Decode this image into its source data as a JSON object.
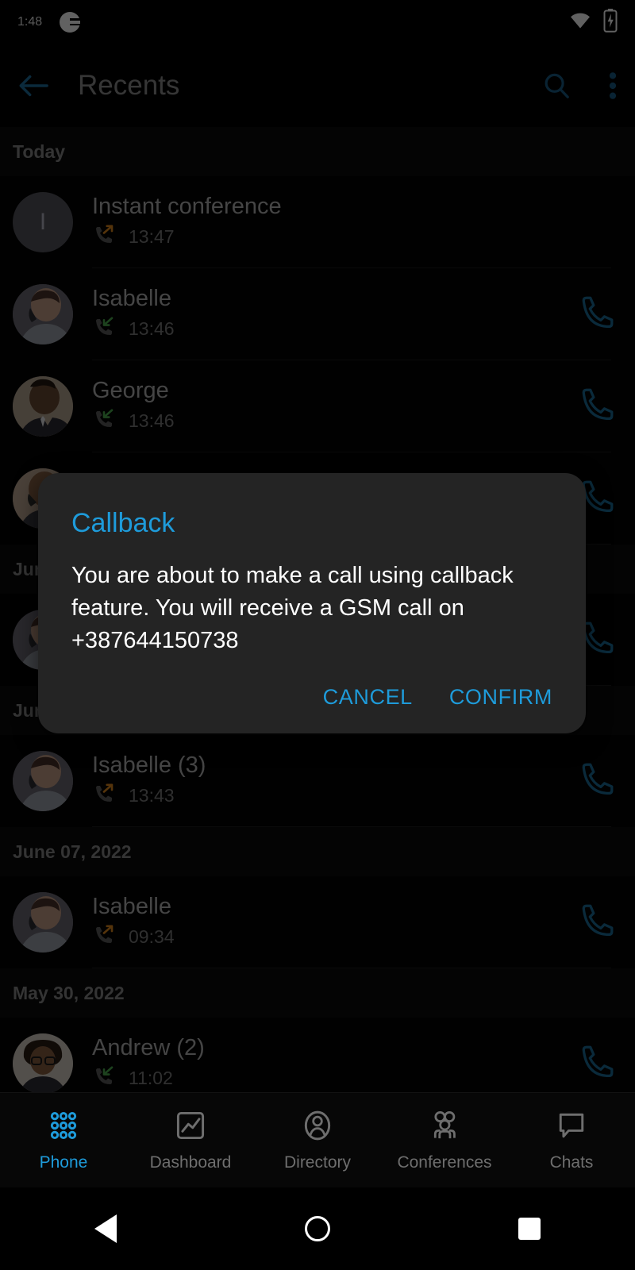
{
  "status_bar": {
    "time": "1:48",
    "app_icon": "notification-app-icon",
    "wifi_icon": "wifi-icon",
    "battery_icon": "battery-charging-icon"
  },
  "app_bar": {
    "back_icon": "arrow-back-icon",
    "title": "Recents",
    "search_icon": "search-icon",
    "overflow_icon": "more-vertical-icon"
  },
  "colors": {
    "accent": "#1e9bda",
    "background": "#000000",
    "list_background": "#050505",
    "dialog_background": "#242424",
    "incoming_arrow": "#4caf50",
    "outgoing_arrow": "#e08a1e",
    "primary_text": "#b6b6b6",
    "secondary_text": "#7c7c7c",
    "header_text": "#8a8a8a"
  },
  "call_list": [
    {
      "type": "date_header",
      "label": "Today"
    },
    {
      "type": "call",
      "name": "Instant conference",
      "time": "13:47",
      "direction": "outgoing",
      "avatar": "letter",
      "avatar_letter": "I",
      "has_call_button": false
    },
    {
      "type": "call",
      "name": "Isabelle",
      "time": "13:46",
      "direction": "incoming",
      "avatar": "photo-woman",
      "has_call_button": true
    },
    {
      "type": "call",
      "name": "George",
      "time": "13:46",
      "direction": "incoming",
      "avatar": "photo-man",
      "has_call_button": true
    },
    {
      "type": "call",
      "name": "",
      "time": "",
      "direction": "incoming",
      "avatar": "photo-man-2",
      "has_call_button": true,
      "obscured": true
    },
    {
      "type": "date_header",
      "label": "Jun",
      "obscured": true
    },
    {
      "type": "call",
      "name": "",
      "time": "",
      "direction": "outgoing",
      "avatar": "photo-woman",
      "has_call_button": true,
      "obscured": true
    },
    {
      "type": "date_header",
      "label": "Jun",
      "obscured": true
    },
    {
      "type": "call",
      "name": "Isabelle (3)",
      "time": "13:43",
      "direction": "outgoing",
      "avatar": "photo-woman",
      "has_call_button": true
    },
    {
      "type": "date_header",
      "label": "June 07, 2022"
    },
    {
      "type": "call",
      "name": "Isabelle",
      "time": "09:34",
      "direction": "outgoing",
      "avatar": "photo-woman",
      "has_call_button": true
    },
    {
      "type": "date_header",
      "label": "May 30, 2022"
    },
    {
      "type": "call",
      "name": "Andrew (2)",
      "time": "11:02",
      "direction": "incoming",
      "avatar": "photo-woman-glasses",
      "has_call_button": true
    }
  ],
  "dialog": {
    "title": "Callback",
    "message": "You are about to make a call using callback feature. You will receive a GSM call on +387644150738",
    "cancel_label": "CANCEL",
    "confirm_label": "CONFIRM"
  },
  "bottom_nav": {
    "active_index": 0,
    "tabs": [
      {
        "label": "Phone",
        "icon": "dialpad-icon"
      },
      {
        "label": "Dashboard",
        "icon": "chart-icon"
      },
      {
        "label": "Directory",
        "icon": "person-icon"
      },
      {
        "label": "Conferences",
        "icon": "people-group-icon"
      },
      {
        "label": "Chats",
        "icon": "chat-bubble-icon"
      }
    ]
  },
  "system_nav": {
    "back": "back-triangle-icon",
    "home": "home-circle-icon",
    "recents": "recents-square-icon"
  }
}
